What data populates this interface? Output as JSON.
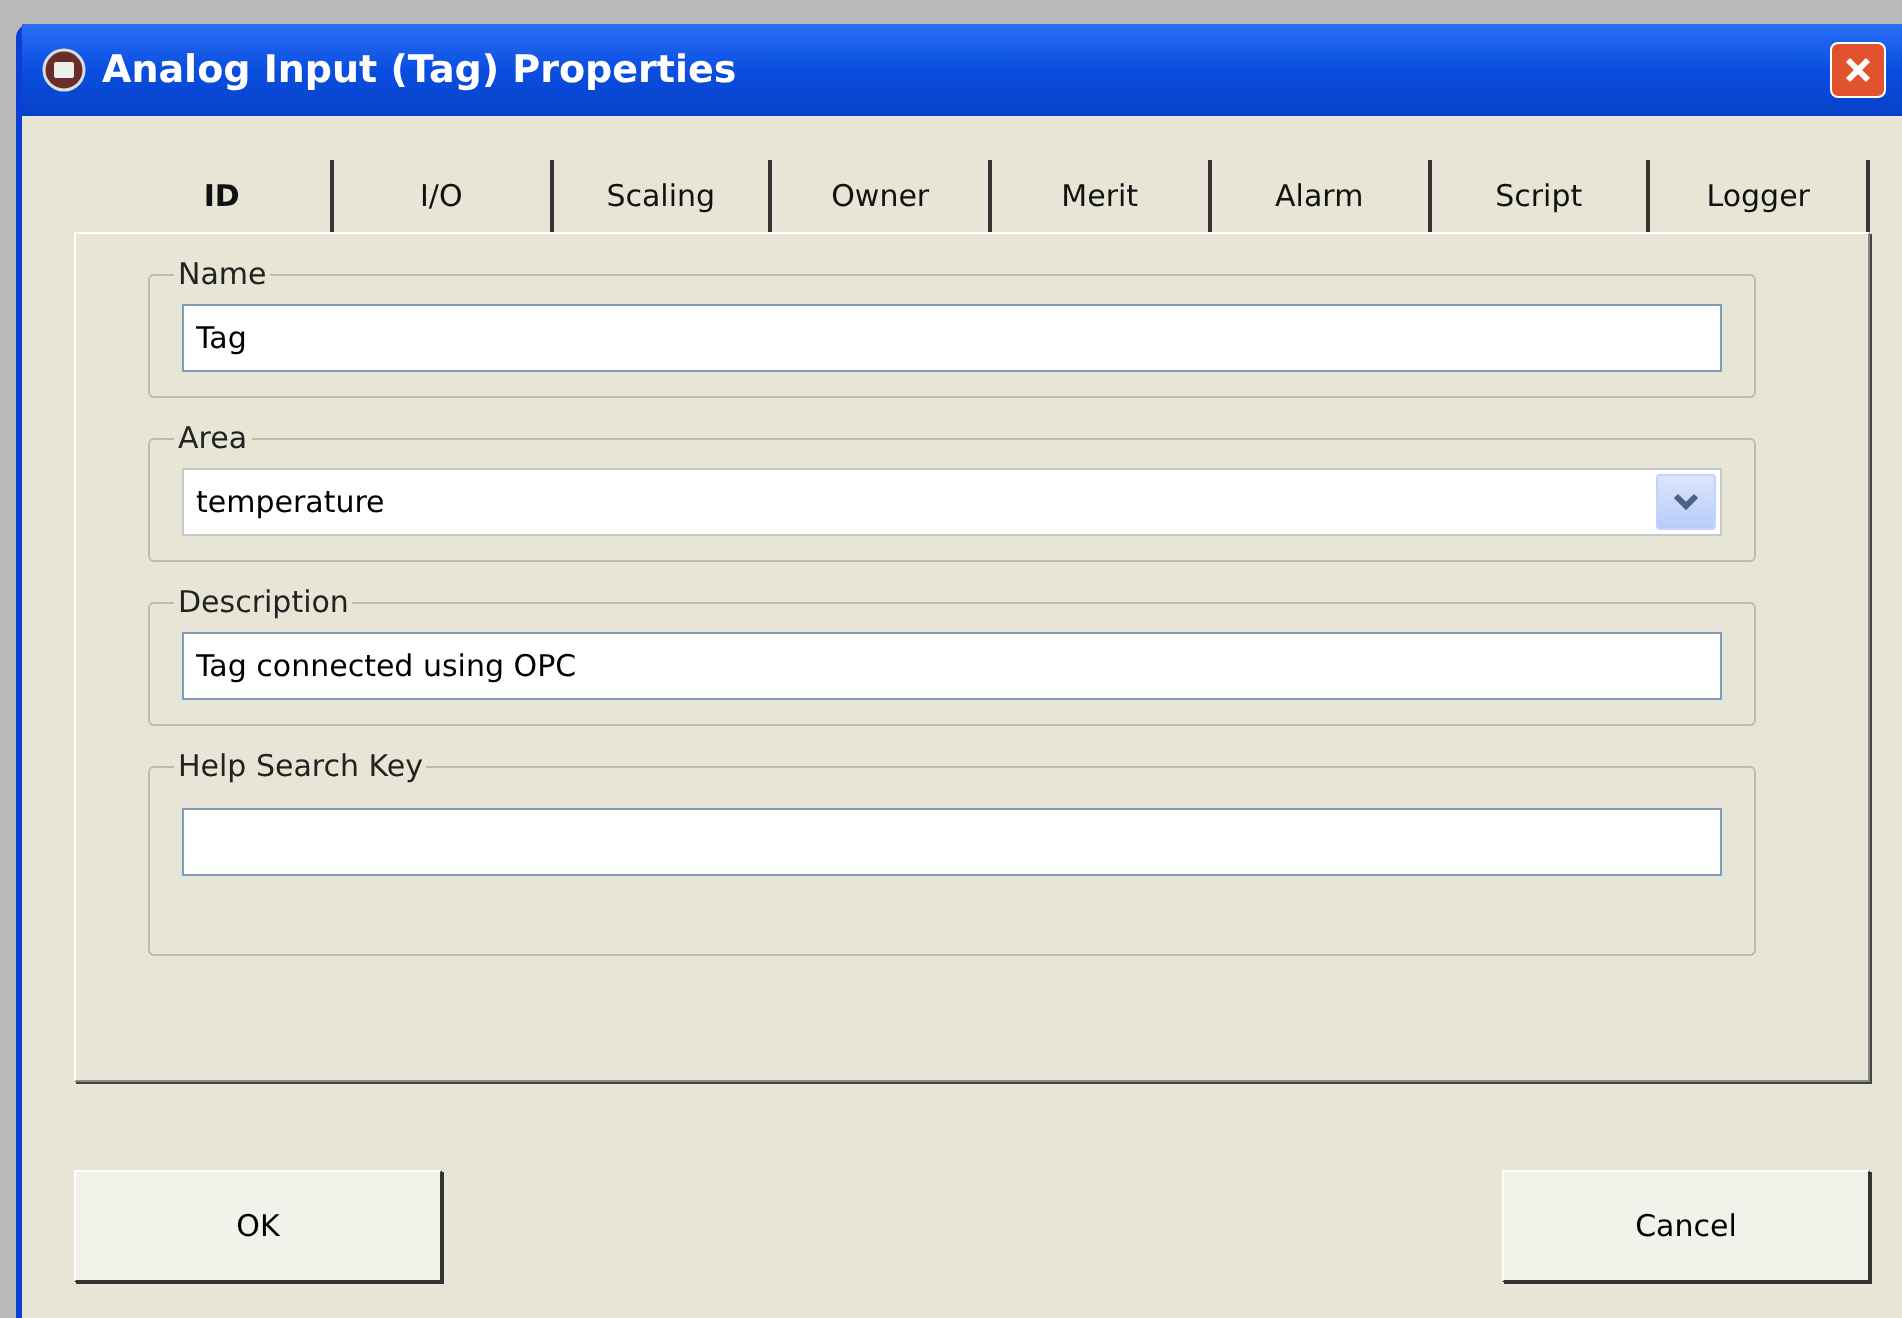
{
  "window": {
    "title": "Analog Input (Tag) Properties"
  },
  "tabs": [
    {
      "label": "ID",
      "selected": true
    },
    {
      "label": "I/O",
      "selected": false
    },
    {
      "label": "Scaling",
      "selected": false
    },
    {
      "label": "Owner",
      "selected": false
    },
    {
      "label": "Merit",
      "selected": false
    },
    {
      "label": "Alarm",
      "selected": false
    },
    {
      "label": "Script",
      "selected": false
    },
    {
      "label": "Logger",
      "selected": false
    }
  ],
  "fields": [
    {
      "label": "Name",
      "kind": "text",
      "value": "Tag"
    },
    {
      "label": "Area",
      "kind": "dropdown",
      "value": "temperature"
    },
    {
      "label": "Description",
      "kind": "text",
      "value": "Tag connected using OPC"
    },
    {
      "label": "Help Search Key",
      "kind": "text"
    }
  ],
  "buttons": [
    "OK",
    "Cancel"
  ]
}
